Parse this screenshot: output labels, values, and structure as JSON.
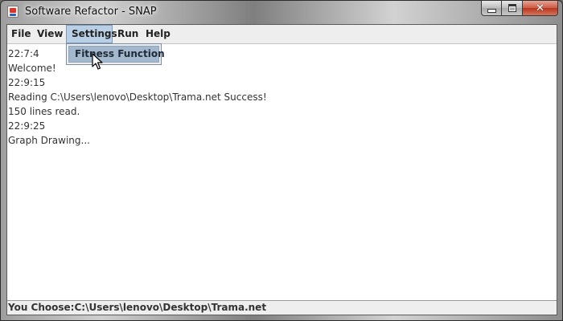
{
  "window": {
    "title": "Software Refactor - SNAP",
    "icon": "java-app-icon",
    "controls": {
      "minimize_icon": "minimize-icon",
      "maximize_icon": "maximize-icon",
      "close_glyph": "✕"
    }
  },
  "menubar": {
    "items": [
      {
        "label": "File"
      },
      {
        "label": "View"
      },
      {
        "label": "Settings"
      },
      {
        "label": "Run"
      },
      {
        "label": "Help"
      }
    ],
    "active_index": 2
  },
  "dropdown": {
    "items": [
      {
        "label": "Fitness Function"
      }
    ],
    "highlighted_index": 0
  },
  "log": {
    "lines": [
      "22:7:4",
      "Welcome!",
      "22:9:15",
      "Reading C:\\Users\\lenovo\\Desktop\\Trama.net Success!",
      "150 lines read.",
      "22:9:25",
      "Graph Drawing..."
    ]
  },
  "status": {
    "text": "You Choose:C:\\Users\\lenovo\\Desktop\\Trama.net"
  },
  "colors": {
    "menu_highlight": "#b8cfe5",
    "dropdown_highlight": "#a3b8cc",
    "close_button": "#c94a32"
  }
}
